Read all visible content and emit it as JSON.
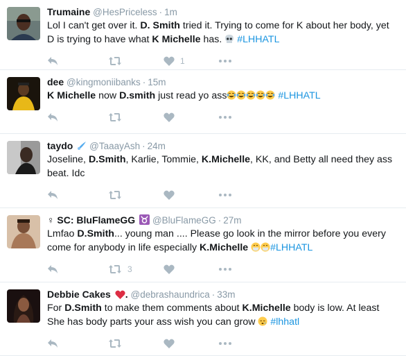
{
  "tweets": [
    {
      "name": "Trumaine",
      "handle": "@HesPriceless",
      "time": "1m",
      "text": [
        {
          "t": "Lol I can't get over it. "
        },
        {
          "t": "D. Smith",
          "b": true
        },
        {
          "t": " tried it. Trying to come for K about her body, yet"
        },
        {
          "br": true
        },
        {
          "t": "D is trying to have what "
        },
        {
          "t": "K Michelle",
          "b": true
        },
        {
          "t": " has. "
        },
        {
          "emoji": "skull"
        },
        {
          "t": " "
        },
        {
          "t": "#LHHATL",
          "h": true
        }
      ],
      "retweets": "",
      "likes": "1",
      "avatar_color": "#3a2a20"
    },
    {
      "name": "dee",
      "handle": "@kingmoniibanks",
      "time": "15m",
      "text": [
        {
          "t": "K Michelle",
          "b": true
        },
        {
          "t": " now "
        },
        {
          "t": "D.smith",
          "b": true
        },
        {
          "t": " just read yo ass"
        },
        {
          "emoji": "joy"
        },
        {
          "emoji": "joy"
        },
        {
          "emoji": "joy"
        },
        {
          "emoji": "joy"
        },
        {
          "emoji": "joy"
        },
        {
          "t": "  "
        },
        {
          "t": "#LHHATL",
          "h": true
        }
      ],
      "retweets": "",
      "likes": "",
      "avatar_color": "#1e1a10"
    },
    {
      "name": "taydo",
      "handle": "@TaaayAsh",
      "time": "24m",
      "text": [
        {
          "t": "Joseline, "
        },
        {
          "t": "D.Smith",
          "b": true
        },
        {
          "t": ", Karlie, Tommie, "
        },
        {
          "t": "K.Michelle",
          "b": true
        },
        {
          "t": ", KK, and Betty all need they ass"
        },
        {
          "br": true
        },
        {
          "t": "beat. Idc"
        }
      ],
      "retweets": "",
      "likes": "",
      "avatar_color": "#4a4a4a"
    },
    {
      "name": "♀ SC: BluFlameGG",
      "handle": "@BluFlameGG",
      "time": "27m",
      "text": [
        {
          "t": "Lmfao "
        },
        {
          "t": "D.Smith",
          "b": true
        },
        {
          "t": "... young man .... Please go look in the mirror before you every"
        },
        {
          "br": true
        },
        {
          "t": "come for anybody in life especially "
        },
        {
          "t": "K.Michelle",
          "b": true
        },
        {
          "t": " "
        },
        {
          "emoji": "mask"
        },
        {
          "emoji": "mask"
        },
        {
          "t": "#LHHATL",
          "h": true
        }
      ],
      "retweets": "3",
      "likes": "",
      "avatar_color": "#8a6a50"
    },
    {
      "name": "Debbie Cakes",
      "handle": "@debrashaundrica",
      "time": "33m",
      "text": [
        {
          "t": "For "
        },
        {
          "t": "D.Smith",
          "b": true
        },
        {
          "t": " to make them comments about "
        },
        {
          "t": "K.Michelle",
          "b": true
        },
        {
          "t": " body is low. At least"
        },
        {
          "br": true
        },
        {
          "t": "She has body parts your ass wish you can grow "
        },
        {
          "emoji": "sleepy"
        },
        {
          "t": " "
        },
        {
          "t": "#lhhatl",
          "h": true
        }
      ],
      "retweets": "",
      "likes": "",
      "avatar_color": "#2a1a18"
    }
  ],
  "colors": {
    "hashtag": "#1b95e0",
    "muted": "#8899a6",
    "icon": "#aab8c2",
    "divider": "#e6ecf0",
    "heart": "#e0245e",
    "zodiac": "#9b59b6",
    "emoji": "#ffcc4d"
  },
  "icons": [
    "reply-icon",
    "retweet-icon",
    "like-icon",
    "more-icon",
    "comet-icon",
    "taurus-icon",
    "heart-emoji",
    "skull-emoji",
    "joy-emoji",
    "mask-emoji",
    "sleepy-emoji"
  ]
}
